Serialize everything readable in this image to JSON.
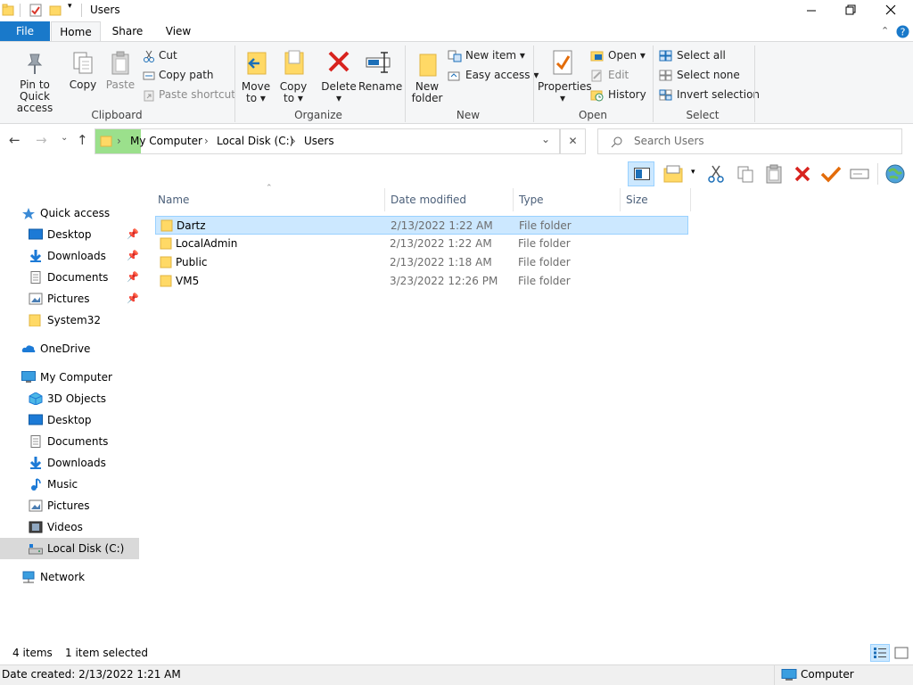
{
  "window": {
    "title": "Users"
  },
  "ribbon": {
    "tabs": [
      {
        "label": "File"
      },
      {
        "label": "Home"
      },
      {
        "label": "Share"
      },
      {
        "label": "View"
      }
    ],
    "clipboard": {
      "group": "Clipboard",
      "pin_line1": "Pin to Quick",
      "pin_line2": "access",
      "copy": "Copy",
      "paste": "Paste",
      "cut": "Cut",
      "copy_path": "Copy path",
      "paste_shortcut": "Paste shortcut"
    },
    "organize": {
      "group": "Organize",
      "move_line1": "Move",
      "move_line2": "to",
      "copy_line1": "Copy",
      "copy_line2": "to",
      "delete": "Delete",
      "rename": "Rename"
    },
    "new": {
      "group": "New",
      "new_folder_line1": "New",
      "new_folder_line2": "folder",
      "new_item": "New item",
      "easy_access": "Easy access"
    },
    "open": {
      "group": "Open",
      "properties": "Properties",
      "open": "Open",
      "edit": "Edit",
      "history": "History"
    },
    "select": {
      "group": "Select",
      "select_all": "Select all",
      "select_none": "Select none",
      "invert": "Invert selection"
    }
  },
  "address": {
    "crumbs": [
      "My Computer",
      "Local Disk (C:)",
      "Users"
    ],
    "search_placeholder": "Search Users"
  },
  "nav": {
    "quick_access": "Quick access",
    "qa_items": [
      "Desktop",
      "Downloads",
      "Documents",
      "Pictures",
      "System32"
    ],
    "onedrive": "OneDrive",
    "my_computer": "My Computer",
    "pc_items": [
      "3D Objects",
      "Desktop",
      "Documents",
      "Downloads",
      "Music",
      "Pictures",
      "Videos",
      "Local Disk (C:)"
    ],
    "network": "Network"
  },
  "files": {
    "columns": [
      "Name",
      "Date modified",
      "Type",
      "Size"
    ],
    "rows": [
      {
        "name": "Dartz",
        "date": "2/13/2022 1:22 AM",
        "type": "File folder"
      },
      {
        "name": "LocalAdmin",
        "date": "2/13/2022 1:22 AM",
        "type": "File folder"
      },
      {
        "name": "Public",
        "date": "2/13/2022 1:18 AM",
        "type": "File folder"
      },
      {
        "name": "VM5",
        "date": "3/23/2022 12:26 PM",
        "type": "File folder"
      }
    ]
  },
  "status": {
    "items": "4 items",
    "selected": "1 item selected",
    "date_created": "Date created: 2/13/2022 1:21 AM",
    "location": "Computer"
  },
  "colors": {
    "accent": "#1979ca",
    "selection": "#cce8ff",
    "folder": "#ffd966"
  },
  "icons": [
    "folder-icon",
    "checkmark-icon",
    "minimize-icon",
    "restore-icon",
    "close-icon",
    "help-icon",
    "pin-icon",
    "copy-icon",
    "paste-icon",
    "cut-icon",
    "delete-icon",
    "rename-icon",
    "properties-icon",
    "search-icon",
    "globe-icon",
    "computer-icon"
  ]
}
